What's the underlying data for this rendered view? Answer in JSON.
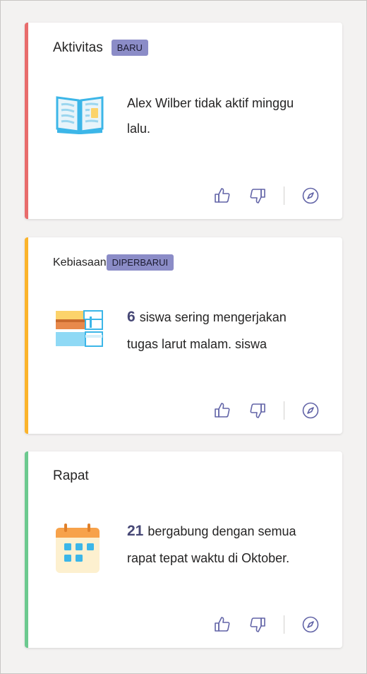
{
  "cards": [
    {
      "title": "Aktivitas",
      "badge": "BARU",
      "accent": "#e86c6c",
      "illustration": "open-book-icon",
      "message": "Alex Wilber tidak aktif minggu lalu.",
      "number": ""
    },
    {
      "title": "Kebiasaan",
      "badge": "DIPERBARUI",
      "accent": "#fbb42c",
      "illustration": "book-stack-icon",
      "number": "6",
      "message": "siswa sering mengerjakan tugas larut malam. siswa"
    },
    {
      "title": "Rapat",
      "badge": "",
      "accent": "#6cc98f",
      "illustration": "calendar-icon",
      "number": "21",
      "message": "bergabung dengan semua rapat tepat waktu di Oktober."
    }
  ],
  "actions": {
    "like_icon": "thumbs-up-icon",
    "dislike_icon": "thumbs-down-icon",
    "explore_icon": "compass-icon"
  },
  "colors": {
    "badge": "#8b8cc7",
    "icon": "#6264a7",
    "background": "#f3f2f1"
  }
}
